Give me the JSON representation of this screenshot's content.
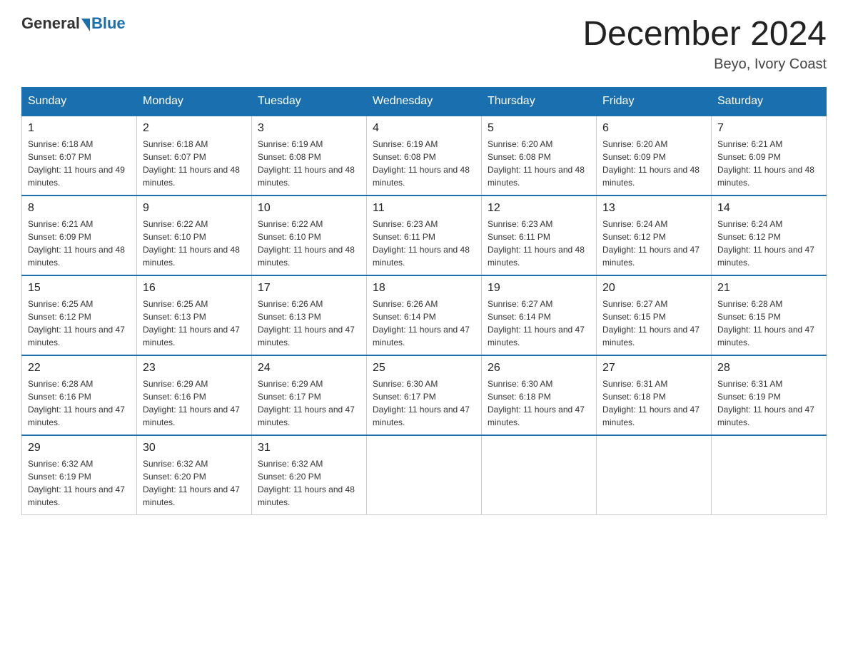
{
  "header": {
    "logo_text_general": "General",
    "logo_text_blue": "Blue",
    "title": "December 2024",
    "location": "Beyo, Ivory Coast"
  },
  "calendar": {
    "days_of_week": [
      "Sunday",
      "Monday",
      "Tuesday",
      "Wednesday",
      "Thursday",
      "Friday",
      "Saturday"
    ],
    "weeks": [
      [
        {
          "day": "1",
          "sunrise": "6:18 AM",
          "sunset": "6:07 PM",
          "daylight": "11 hours and 49 minutes."
        },
        {
          "day": "2",
          "sunrise": "6:18 AM",
          "sunset": "6:07 PM",
          "daylight": "11 hours and 48 minutes."
        },
        {
          "day": "3",
          "sunrise": "6:19 AM",
          "sunset": "6:08 PM",
          "daylight": "11 hours and 48 minutes."
        },
        {
          "day": "4",
          "sunrise": "6:19 AM",
          "sunset": "6:08 PM",
          "daylight": "11 hours and 48 minutes."
        },
        {
          "day": "5",
          "sunrise": "6:20 AM",
          "sunset": "6:08 PM",
          "daylight": "11 hours and 48 minutes."
        },
        {
          "day": "6",
          "sunrise": "6:20 AM",
          "sunset": "6:09 PM",
          "daylight": "11 hours and 48 minutes."
        },
        {
          "day": "7",
          "sunrise": "6:21 AM",
          "sunset": "6:09 PM",
          "daylight": "11 hours and 48 minutes."
        }
      ],
      [
        {
          "day": "8",
          "sunrise": "6:21 AM",
          "sunset": "6:09 PM",
          "daylight": "11 hours and 48 minutes."
        },
        {
          "day": "9",
          "sunrise": "6:22 AM",
          "sunset": "6:10 PM",
          "daylight": "11 hours and 48 minutes."
        },
        {
          "day": "10",
          "sunrise": "6:22 AM",
          "sunset": "6:10 PM",
          "daylight": "11 hours and 48 minutes."
        },
        {
          "day": "11",
          "sunrise": "6:23 AM",
          "sunset": "6:11 PM",
          "daylight": "11 hours and 48 minutes."
        },
        {
          "day": "12",
          "sunrise": "6:23 AM",
          "sunset": "6:11 PM",
          "daylight": "11 hours and 48 minutes."
        },
        {
          "day": "13",
          "sunrise": "6:24 AM",
          "sunset": "6:12 PM",
          "daylight": "11 hours and 47 minutes."
        },
        {
          "day": "14",
          "sunrise": "6:24 AM",
          "sunset": "6:12 PM",
          "daylight": "11 hours and 47 minutes."
        }
      ],
      [
        {
          "day": "15",
          "sunrise": "6:25 AM",
          "sunset": "6:12 PM",
          "daylight": "11 hours and 47 minutes."
        },
        {
          "day": "16",
          "sunrise": "6:25 AM",
          "sunset": "6:13 PM",
          "daylight": "11 hours and 47 minutes."
        },
        {
          "day": "17",
          "sunrise": "6:26 AM",
          "sunset": "6:13 PM",
          "daylight": "11 hours and 47 minutes."
        },
        {
          "day": "18",
          "sunrise": "6:26 AM",
          "sunset": "6:14 PM",
          "daylight": "11 hours and 47 minutes."
        },
        {
          "day": "19",
          "sunrise": "6:27 AM",
          "sunset": "6:14 PM",
          "daylight": "11 hours and 47 minutes."
        },
        {
          "day": "20",
          "sunrise": "6:27 AM",
          "sunset": "6:15 PM",
          "daylight": "11 hours and 47 minutes."
        },
        {
          "day": "21",
          "sunrise": "6:28 AM",
          "sunset": "6:15 PM",
          "daylight": "11 hours and 47 minutes."
        }
      ],
      [
        {
          "day": "22",
          "sunrise": "6:28 AM",
          "sunset": "6:16 PM",
          "daylight": "11 hours and 47 minutes."
        },
        {
          "day": "23",
          "sunrise": "6:29 AM",
          "sunset": "6:16 PM",
          "daylight": "11 hours and 47 minutes."
        },
        {
          "day": "24",
          "sunrise": "6:29 AM",
          "sunset": "6:17 PM",
          "daylight": "11 hours and 47 minutes."
        },
        {
          "day": "25",
          "sunrise": "6:30 AM",
          "sunset": "6:17 PM",
          "daylight": "11 hours and 47 minutes."
        },
        {
          "day": "26",
          "sunrise": "6:30 AM",
          "sunset": "6:18 PM",
          "daylight": "11 hours and 47 minutes."
        },
        {
          "day": "27",
          "sunrise": "6:31 AM",
          "sunset": "6:18 PM",
          "daylight": "11 hours and 47 minutes."
        },
        {
          "day": "28",
          "sunrise": "6:31 AM",
          "sunset": "6:19 PM",
          "daylight": "11 hours and 47 minutes."
        }
      ],
      [
        {
          "day": "29",
          "sunrise": "6:32 AM",
          "sunset": "6:19 PM",
          "daylight": "11 hours and 47 minutes."
        },
        {
          "day": "30",
          "sunrise": "6:32 AM",
          "sunset": "6:20 PM",
          "daylight": "11 hours and 47 minutes."
        },
        {
          "day": "31",
          "sunrise": "6:32 AM",
          "sunset": "6:20 PM",
          "daylight": "11 hours and 48 minutes."
        },
        null,
        null,
        null,
        null
      ]
    ]
  }
}
